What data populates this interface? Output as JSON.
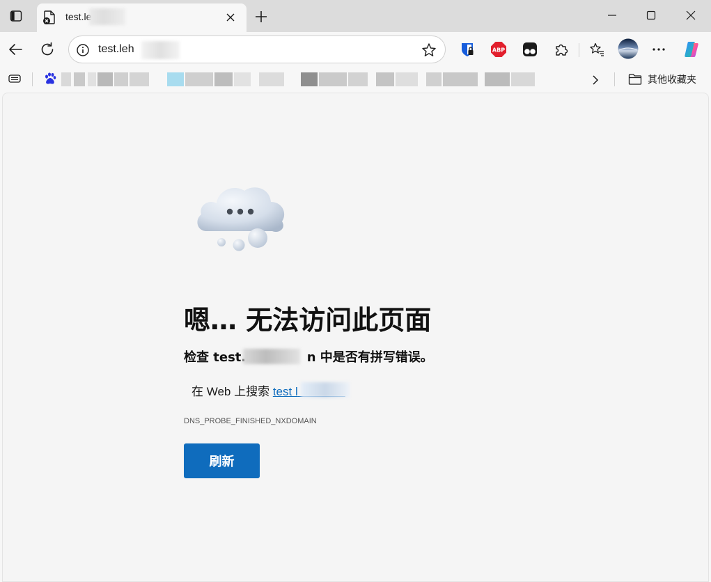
{
  "tab": {
    "title": "test.le",
    "close_icon": "close-icon",
    "favicon": "page-error-icon"
  },
  "window": {
    "minimize_icon": "minimize-icon",
    "maximize_icon": "maximize-icon",
    "close_icon": "close-icon"
  },
  "address_bar": {
    "url": "test.leh",
    "info_icon": "info-icon",
    "favorite_icon": "star-icon"
  },
  "toolbar": {
    "icons": [
      "back-icon",
      "refresh-icon",
      "bitwarden-icon",
      "adblock-plus-icon",
      "tampermonkey-icon",
      "extensions-icon",
      "favorites-icon",
      "profile-avatar",
      "more-icon",
      "copilot-icon"
    ],
    "adblock_label": "ABP"
  },
  "bookmarks": {
    "other_favorites_label": "其他收藏夹"
  },
  "error": {
    "title": "嗯… 无法访问此页面",
    "subtitle_prefix": "检查 test.l",
    "subtitle_mid": "n",
    "subtitle_suffix": " 中是否有拼写错误。",
    "suggest_prefix": "在 Web 上搜索 ",
    "suggest_link": "test l",
    "code": "DNS_PROBE_FINISHED_NXDOMAIN",
    "refresh_label": "刷新"
  },
  "colors": {
    "accent": "#0f6cbd",
    "tabstrip": "#dcdcdc",
    "page_background": "#f5f5f5"
  }
}
